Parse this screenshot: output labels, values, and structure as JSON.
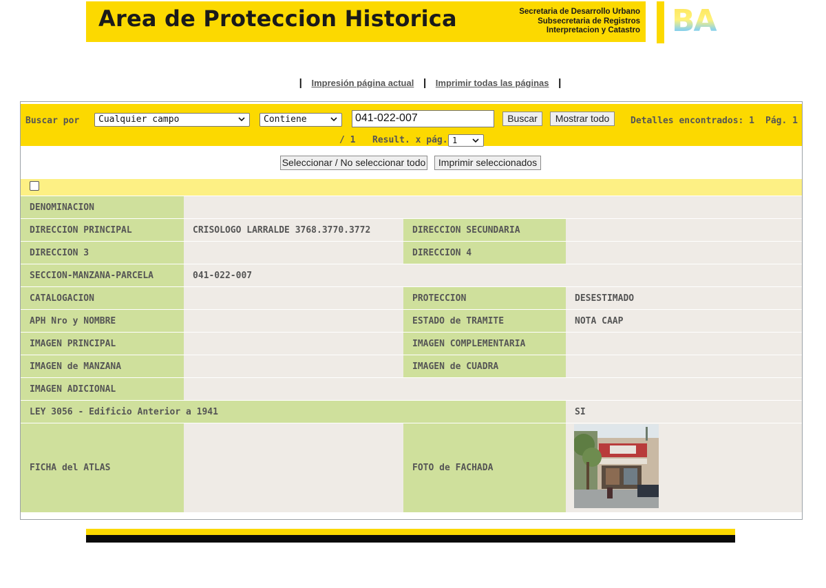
{
  "header": {
    "title": "Area de Proteccion Historica",
    "org_lines": [
      "Secretaria de Desarrollo Urbano",
      "Subsecretaria de Registros",
      "Interpretacion y Catastro"
    ],
    "logo_text": "BA"
  },
  "print_links": {
    "current_page": "Impresión página actual",
    "all_pages": "Imprimir todas las páginas"
  },
  "search": {
    "label": "Buscar por",
    "field_selected": "Cualquier campo",
    "operator_selected": "Contiene",
    "query_value": "041-022-007",
    "search_button": "Buscar",
    "show_all_button": "Mostrar todo",
    "found_text": "Detalles encontrados: 1",
    "page_text": "Pág. 1",
    "total_pages_text": "/ 1",
    "per_page_label": "Result. x pág.:",
    "per_page_selected": "1"
  },
  "actions": {
    "select_all": "Seleccionar / No seleccionar todo",
    "print_selected": "Imprimir seleccionados"
  },
  "record": {
    "denominacion": {
      "label": "DENOMINACION",
      "value": ""
    },
    "direccion_principal": {
      "label": "DIRECCION PRINCIPAL",
      "value": "CRISOLOGO LARRALDE 3768.3770.3772"
    },
    "direccion_secundaria": {
      "label": "DIRECCION SECUNDARIA",
      "value": ""
    },
    "direccion_3": {
      "label": "DIRECCION 3",
      "value": ""
    },
    "direccion_4": {
      "label": "DIRECCION 4",
      "value": ""
    },
    "smp": {
      "label": "SECCION-MANZANA-PARCELA",
      "value": "041-022-007"
    },
    "catalogacion": {
      "label": "CATALOGACION",
      "value": ""
    },
    "proteccion": {
      "label": "PROTECCION",
      "value": "DESESTIMADO"
    },
    "aph": {
      "label": "APH Nro y NOMBRE",
      "value": ""
    },
    "estado_tramite": {
      "label": "ESTADO de TRAMITE",
      "value": "NOTA CAAP"
    },
    "imagen_principal": {
      "label": "IMAGEN PRINCIPAL",
      "value": ""
    },
    "imagen_complementaria": {
      "label": "IMAGEN COMPLEMENTARIA",
      "value": ""
    },
    "imagen_manzana": {
      "label": "IMAGEN de MANZANA",
      "value": ""
    },
    "imagen_cuadra": {
      "label": "IMAGEN de CUADRA",
      "value": ""
    },
    "imagen_adicional": {
      "label": "IMAGEN ADICIONAL",
      "value": ""
    },
    "ley_3056": {
      "label": "LEY 3056 - Edificio Anterior a 1941",
      "value": "SI"
    },
    "ficha_atlas": {
      "label": "FICHA del ATLAS",
      "value": ""
    },
    "foto_fachada": {
      "label": "FOTO de FACHADA"
    }
  },
  "colors": {
    "brand_yellow": "#fcd900",
    "label_green": "#cfe09c",
    "value_beige": "#efebe6",
    "strip_yellow": "#fdf084"
  }
}
